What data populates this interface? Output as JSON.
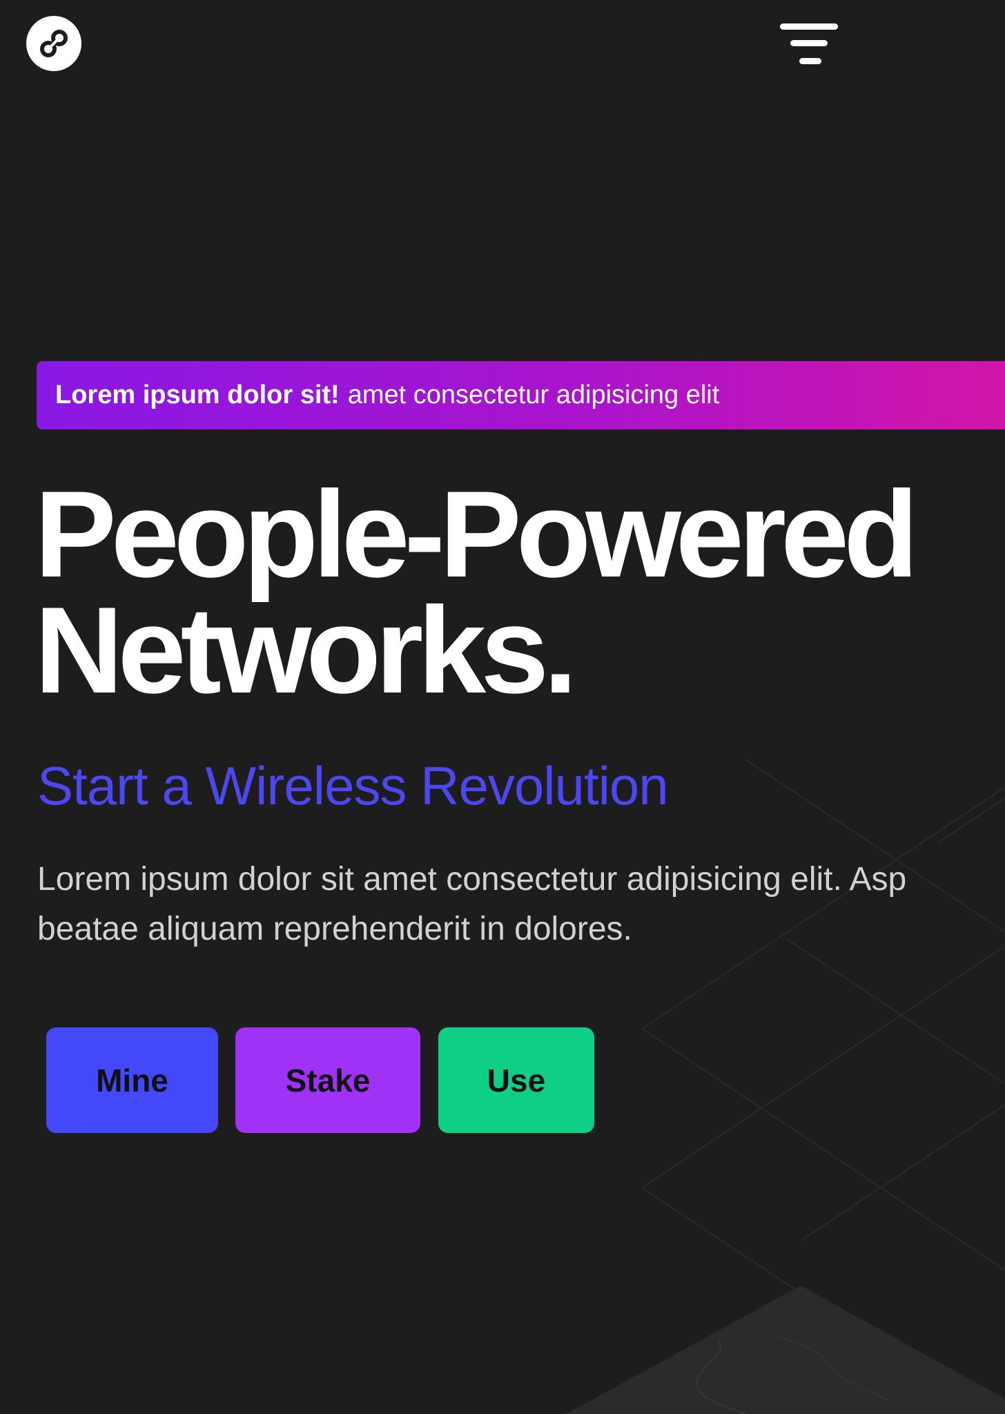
{
  "header": {
    "logo_icon": "helium-logo-icon",
    "menu_icon": "hamburger-menu-icon"
  },
  "banner": {
    "strong_text": "Lorem ipsum dolor sit!",
    "text": "amet consectetur adipisicing elit"
  },
  "hero": {
    "headline_line1": "People-Powered",
    "headline_line2": "Networks.",
    "subtitle": "Start a Wireless Revolution",
    "description_line1": "Lorem ipsum dolor sit amet consectetur adipisicing elit. Asp",
    "description_line2": "beatae aliquam reprehenderit in dolores."
  },
  "actions": {
    "mine_label": "Mine",
    "stake_label": "Stake",
    "use_label": "Use"
  },
  "colors": {
    "background": "#1d1d1e",
    "subtitle": "#4c47f0",
    "mine": "#4448fb",
    "stake": "#a032f8",
    "use": "#0ecf84",
    "banner_start": "#8a18e4",
    "banner_end": "#d215a8"
  }
}
